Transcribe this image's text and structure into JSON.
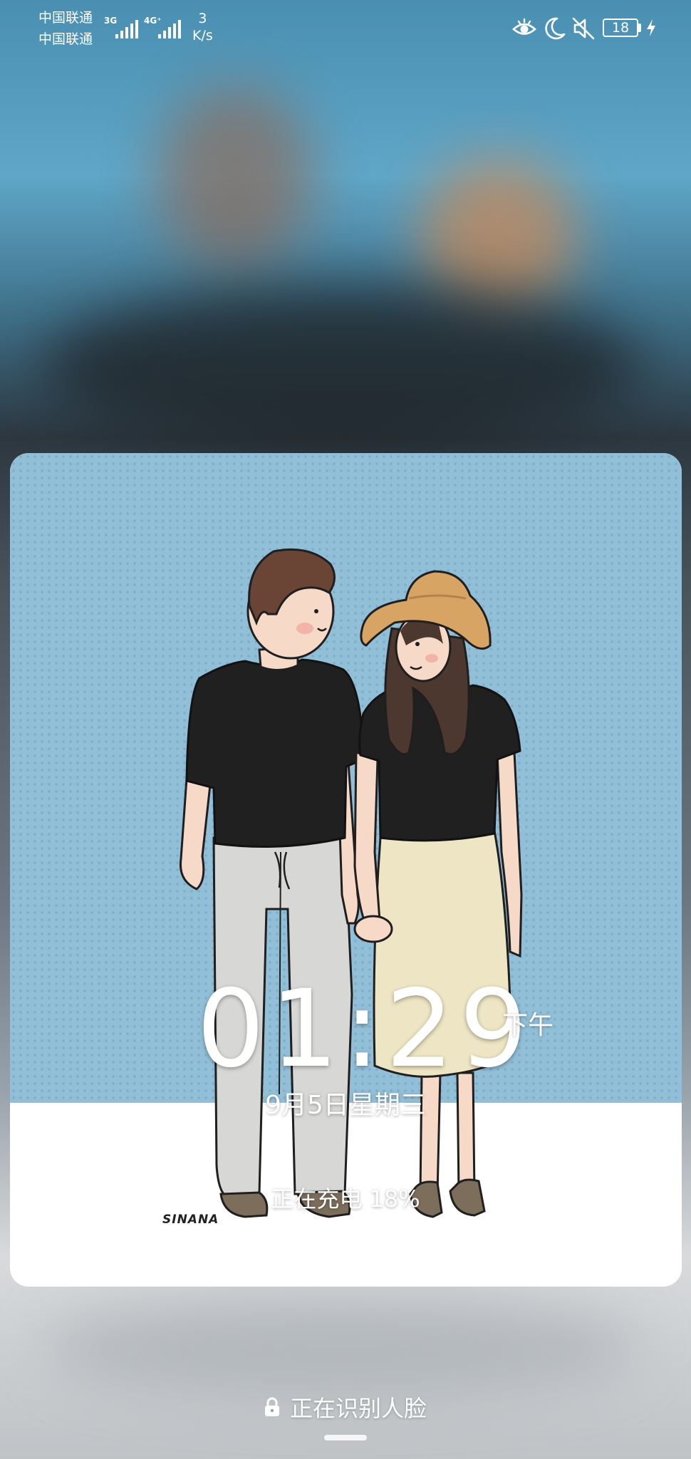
{
  "status_bar": {
    "carrier_1": "中国联通",
    "carrier_2": "中国联通",
    "sim1_network": "3G",
    "sim2_network": "4G⁺",
    "speed_value": "3",
    "speed_unit": "K/s",
    "battery_level": "18",
    "icons": [
      "eye-comfort-icon",
      "moon-icon",
      "mute-icon",
      "battery-icon",
      "charging-bolt-icon"
    ]
  },
  "wallpaper": {
    "signature": "SINANA"
  },
  "lock_screen": {
    "time": "01:29",
    "ampm": "下午",
    "date": "9月5日星期三",
    "charging_status": "正在充电 18%",
    "face_recognition": "正在识别人脸"
  },
  "colors": {
    "sky": "#92bfd8",
    "text": "#ffffff"
  }
}
